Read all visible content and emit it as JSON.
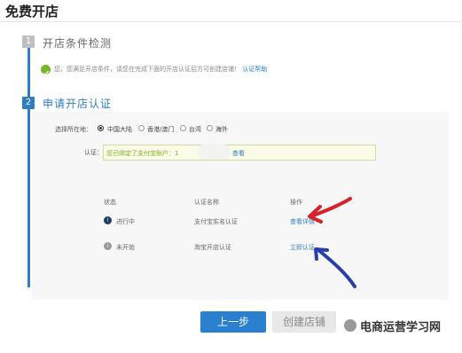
{
  "header": {
    "title": "免费开店"
  },
  "steps": [
    {
      "number": "1",
      "title": "开店条件检测"
    },
    {
      "number": "2",
      "title": "申请开店认证"
    }
  ],
  "notice": {
    "text": "您，您满足开店条件，请您在完成下面的开店认证后方可创建店铺！",
    "link": "认证帮助"
  },
  "region": {
    "label": "选择所在地：",
    "options": [
      "中国大陆",
      "香港/澳门",
      "台湾",
      "海外"
    ],
    "selected": "中国大陆"
  },
  "certification": {
    "label": "认证：",
    "text": "您已绑定了支付宝账户：1",
    "link": "查看"
  },
  "table": {
    "headers": [
      "状态",
      "认证名称",
      "操作"
    ],
    "rows": [
      {
        "status": "进行中",
        "name": "支付宝实名认证",
        "action": "查看详情"
      },
      {
        "status": "未开始",
        "name": "淘宝开店认证",
        "action": "立即认证"
      }
    ]
  },
  "buttons": {
    "prev": "上一步",
    "create": "创建店铺"
  },
  "watermark": "电商运营学习网",
  "colors": {
    "accent": "#2e7dc5",
    "success": "#7ab528",
    "arrow_red": "#d6232a",
    "arrow_blue": "#2a3fa8"
  }
}
